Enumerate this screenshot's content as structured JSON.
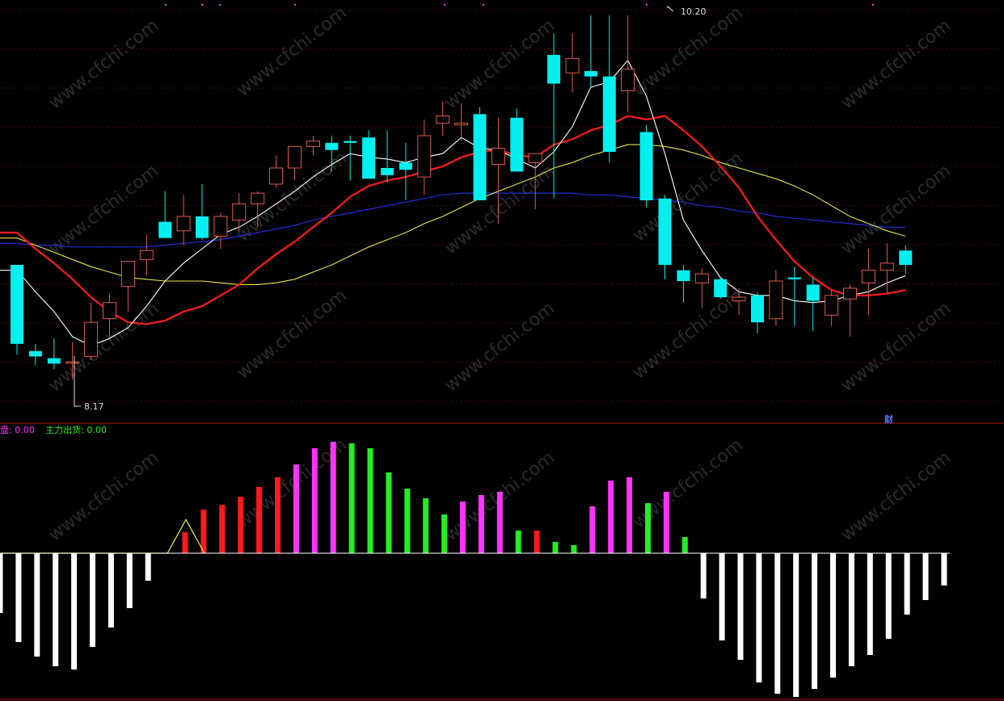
{
  "chart_data": [
    {
      "type": "candlestick",
      "title": "",
      "price_range": [
        8.0,
        10.25
      ],
      "grid": true,
      "labels": {
        "high": "10.20",
        "low": "8.17",
        "finance_marker": "财"
      },
      "colors": {
        "up": "#e05a4e",
        "down": "#00f0f0",
        "ma5": "#ffffff",
        "ma10": "#ff1a1a",
        "ma20": "#e5e54a",
        "ma60": "#1f2fd0"
      },
      "candles": [
        {
          "o": 8.81,
          "h": 8.81,
          "l": 8.31,
          "c": 8.37
        },
        {
          "o": 8.33,
          "h": 8.37,
          "l": 8.25,
          "c": 8.3
        },
        {
          "o": 8.29,
          "h": 8.4,
          "l": 8.23,
          "c": 8.26
        },
        {
          "o": 8.27,
          "h": 8.38,
          "l": 8.17,
          "c": 8.27
        },
        {
          "o": 8.3,
          "h": 8.6,
          "l": 8.28,
          "c": 8.49
        },
        {
          "o": 8.51,
          "h": 8.65,
          "l": 8.4,
          "c": 8.6
        },
        {
          "o": 8.69,
          "h": 8.79,
          "l": 8.55,
          "c": 8.83
        },
        {
          "o": 8.84,
          "h": 8.98,
          "l": 8.75,
          "c": 8.89
        },
        {
          "o": 9.05,
          "h": 9.22,
          "l": 8.96,
          "c": 8.96
        },
        {
          "o": 9.0,
          "h": 9.2,
          "l": 8.92,
          "c": 9.08
        },
        {
          "o": 9.08,
          "h": 9.26,
          "l": 8.95,
          "c": 8.96
        },
        {
          "o": 8.97,
          "h": 9.1,
          "l": 8.9,
          "c": 9.08
        },
        {
          "o": 9.06,
          "h": 9.21,
          "l": 8.99,
          "c": 9.15
        },
        {
          "o": 9.15,
          "h": 9.22,
          "l": 9.02,
          "c": 9.21
        },
        {
          "o": 9.26,
          "h": 9.42,
          "l": 9.24,
          "c": 9.35
        },
        {
          "o": 9.35,
          "h": 9.4,
          "l": 9.28,
          "c": 9.47
        },
        {
          "o": 9.47,
          "h": 9.53,
          "l": 9.42,
          "c": 9.5
        },
        {
          "o": 9.49,
          "h": 9.53,
          "l": 9.33,
          "c": 9.45
        },
        {
          "o": 9.5,
          "h": 9.53,
          "l": 9.28,
          "c": 9.49
        },
        {
          "o": 9.52,
          "h": 9.56,
          "l": 9.3,
          "c": 9.29
        },
        {
          "o": 9.35,
          "h": 9.56,
          "l": 9.27,
          "c": 9.31
        },
        {
          "o": 9.38,
          "h": 9.49,
          "l": 9.17,
          "c": 9.34
        },
        {
          "o": 9.3,
          "h": 9.62,
          "l": 9.2,
          "c": 9.53
        },
        {
          "o": 9.6,
          "h": 9.72,
          "l": 9.53,
          "c": 9.64
        },
        {
          "o": 9.59,
          "h": 9.71,
          "l": 9.5,
          "c": 9.6
        },
        {
          "o": 9.65,
          "h": 9.69,
          "l": 9.2,
          "c": 9.17
        },
        {
          "o": 9.37,
          "h": 9.63,
          "l": 9.04,
          "c": 9.46
        },
        {
          "o": 9.63,
          "h": 9.68,
          "l": 9.33,
          "c": 9.33
        },
        {
          "o": 9.38,
          "h": 9.41,
          "l": 9.12,
          "c": 9.43
        },
        {
          "o": 9.98,
          "h": 10.1,
          "l": 9.18,
          "c": 9.82
        },
        {
          "o": 9.88,
          "h": 10.1,
          "l": 9.77,
          "c": 9.96
        },
        {
          "o": 9.89,
          "h": 10.2,
          "l": 9.8,
          "c": 9.86
        },
        {
          "o": 9.86,
          "h": 10.2,
          "l": 9.38,
          "c": 9.44
        },
        {
          "o": 9.78,
          "h": 10.2,
          "l": 9.66,
          "c": 9.9
        },
        {
          "o": 9.55,
          "h": 9.59,
          "l": 9.13,
          "c": 9.17
        },
        {
          "o": 9.18,
          "h": 9.2,
          "l": 8.73,
          "c": 8.81
        },
        {
          "o": 8.78,
          "h": 8.81,
          "l": 8.6,
          "c": 8.72
        },
        {
          "o": 8.71,
          "h": 8.79,
          "l": 8.57,
          "c": 8.76
        },
        {
          "o": 8.73,
          "h": 8.74,
          "l": 8.62,
          "c": 8.63
        },
        {
          "o": 8.61,
          "h": 8.68,
          "l": 8.53,
          "c": 8.63
        },
        {
          "o": 8.64,
          "h": 8.66,
          "l": 8.43,
          "c": 8.49
        },
        {
          "o": 8.51,
          "h": 8.78,
          "l": 8.47,
          "c": 8.72
        },
        {
          "o": 8.74,
          "h": 8.8,
          "l": 8.47,
          "c": 8.73
        },
        {
          "o": 8.7,
          "h": 8.74,
          "l": 8.44,
          "c": 8.61
        },
        {
          "o": 8.53,
          "h": 8.67,
          "l": 8.47,
          "c": 8.64
        },
        {
          "o": 8.62,
          "h": 8.7,
          "l": 8.41,
          "c": 8.68
        },
        {
          "o": 8.71,
          "h": 8.9,
          "l": 8.53,
          "c": 8.78
        },
        {
          "o": 8.78,
          "h": 8.93,
          "l": 8.65,
          "c": 8.82
        },
        {
          "o": 8.89,
          "h": 8.92,
          "l": 8.76,
          "c": 8.81
        }
      ],
      "ma5": [
        8.78,
        8.66,
        8.55,
        8.41,
        8.36,
        8.4,
        8.46,
        8.58,
        8.72,
        8.82,
        8.9,
        8.98,
        9.02,
        9.08,
        9.15,
        9.22,
        9.3,
        9.37,
        9.43,
        9.41,
        9.4,
        9.38,
        9.41,
        9.43,
        9.52,
        9.46,
        9.45,
        9.4,
        9.35,
        9.44,
        9.58,
        9.8,
        9.83,
        9.95,
        9.75,
        9.43,
        9.06,
        8.89,
        8.74,
        8.66,
        8.64,
        8.64,
        8.61,
        8.6,
        8.61,
        8.64,
        8.66,
        8.71,
        8.75
      ],
      "ma10": [
        8.99,
        8.9,
        8.82,
        8.73,
        8.63,
        8.55,
        8.49,
        8.48,
        8.5,
        8.55,
        8.58,
        8.64,
        8.7,
        8.79,
        8.87,
        8.94,
        9.02,
        9.1,
        9.19,
        9.25,
        9.28,
        9.3,
        9.33,
        9.36,
        9.41,
        9.44,
        9.45,
        9.42,
        9.41,
        9.48,
        9.51,
        9.56,
        9.59,
        9.64,
        9.62,
        9.64,
        9.56,
        9.47,
        9.36,
        9.24,
        9.08,
        8.95,
        8.83,
        8.74,
        8.67,
        8.64,
        8.64,
        8.65,
        8.67
      ],
      "ma20": [
        8.96,
        8.92,
        8.88,
        8.84,
        8.8,
        8.77,
        8.74,
        8.73,
        8.72,
        8.72,
        8.72,
        8.71,
        8.7,
        8.7,
        8.71,
        8.73,
        8.77,
        8.81,
        8.86,
        8.91,
        8.95,
        8.99,
        9.04,
        9.08,
        9.13,
        9.18,
        9.22,
        9.26,
        9.3,
        9.35,
        9.38,
        9.42,
        9.45,
        9.48,
        9.48,
        9.47,
        9.45,
        9.42,
        9.38,
        9.35,
        9.32,
        9.29,
        9.25,
        9.2,
        9.14,
        9.08,
        9.04,
        9.0,
        8.97
      ],
      "ma60": [
        8.93,
        8.92,
        8.92,
        8.91,
        8.91,
        8.91,
        8.91,
        8.91,
        8.92,
        8.93,
        8.94,
        8.95,
        8.97,
        8.99,
        9.01,
        9.03,
        9.06,
        9.08,
        9.1,
        9.12,
        9.14,
        9.16,
        9.18,
        9.2,
        9.21,
        9.21,
        9.21,
        9.21,
        9.21,
        9.21,
        9.21,
        9.2,
        9.2,
        9.19,
        9.18,
        9.17,
        9.16,
        9.14,
        9.13,
        9.11,
        9.1,
        9.08,
        9.07,
        9.06,
        9.05,
        9.04,
        9.03,
        9.02,
        9.02
      ]
    },
    {
      "type": "bar",
      "title": "",
      "legend": [
        {
          "label": "盘: 0.00",
          "color": "#ff33ff"
        },
        {
          "label": "主力出货: 0.00",
          "color": "#22ee22"
        }
      ],
      "value_range": [
        -90,
        70
      ],
      "colors": {
        "white": "#ffffff",
        "red": "#ff1a1a",
        "magenta": "#ff33ff",
        "green": "#22ee22",
        "line": "#e5e54a"
      },
      "bars": [
        {
          "v": -37,
          "c": "white"
        },
        {
          "v": -55,
          "c": "white"
        },
        {
          "v": -64,
          "c": "white"
        },
        {
          "v": -70,
          "c": "white"
        },
        {
          "v": -72,
          "c": "white"
        },
        {
          "v": -58,
          "c": "white"
        },
        {
          "v": -46,
          "c": "white"
        },
        {
          "v": -34,
          "c": "white"
        },
        {
          "v": -17,
          "c": "white"
        },
        {
          "v": 0,
          "c": "white"
        },
        {
          "v": 13,
          "c": "red"
        },
        {
          "v": 27,
          "c": "red"
        },
        {
          "v": 30,
          "c": "red"
        },
        {
          "v": 35,
          "c": "red"
        },
        {
          "v": 41,
          "c": "red"
        },
        {
          "v": 47,
          "c": "red"
        },
        {
          "v": 55,
          "c": "magenta"
        },
        {
          "v": 65,
          "c": "magenta"
        },
        {
          "v": 69,
          "c": "magenta"
        },
        {
          "v": 68,
          "c": "green"
        },
        {
          "v": 65,
          "c": "green"
        },
        {
          "v": 50,
          "c": "green"
        },
        {
          "v": 40,
          "c": "green"
        },
        {
          "v": 34,
          "c": "green"
        },
        {
          "v": 24,
          "c": "green"
        },
        {
          "v": 32,
          "c": "magenta"
        },
        {
          "v": 36,
          "c": "magenta"
        },
        {
          "v": 38,
          "c": "magenta"
        },
        {
          "v": 14,
          "c": "green"
        },
        {
          "v": 14,
          "c": "red"
        },
        {
          "v": 7,
          "c": "green"
        },
        {
          "v": 5,
          "c": "green"
        },
        {
          "v": 29,
          "c": "magenta"
        },
        {
          "v": 45,
          "c": "magenta"
        },
        {
          "v": 47,
          "c": "magenta"
        },
        {
          "v": 31,
          "c": "green"
        },
        {
          "v": 38,
          "c": "magenta"
        },
        {
          "v": 10,
          "c": "green"
        },
        {
          "v": -28,
          "c": "white"
        },
        {
          "v": -54,
          "c": "white"
        },
        {
          "v": -66,
          "c": "white"
        },
        {
          "v": -80,
          "c": "white"
        },
        {
          "v": -87,
          "c": "white"
        },
        {
          "v": -89,
          "c": "white"
        },
        {
          "v": -84,
          "c": "white"
        },
        {
          "v": -77,
          "c": "white"
        },
        {
          "v": -70,
          "c": "white"
        },
        {
          "v": -63,
          "c": "white"
        },
        {
          "v": -53,
          "c": "white"
        },
        {
          "v": -38,
          "c": "white"
        },
        {
          "v": -29,
          "c": "white"
        },
        {
          "v": -20,
          "c": "white"
        }
      ],
      "line": [
        0,
        0,
        0,
        0,
        0,
        0,
        0,
        0,
        0,
        0,
        52,
        0
      ]
    }
  ]
}
